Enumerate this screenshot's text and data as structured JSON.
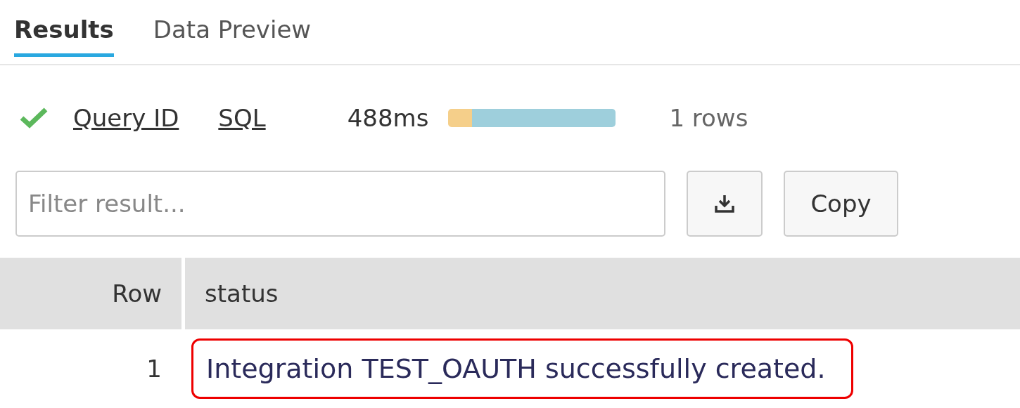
{
  "tabs": [
    {
      "label": "Results",
      "selected": true
    },
    {
      "label": "Data Preview",
      "selected": false
    }
  ],
  "query": {
    "succeeded": true,
    "links": [
      "Query ID",
      "SQL"
    ],
    "duration": "488ms",
    "timing": [
      {
        "color": "#f5cf8a",
        "level": 0.14
      },
      {
        "color": "#9ecfdc",
        "level": 0.86
      }
    ],
    "row_count": "1 rows"
  },
  "filter": {
    "placeholder": "Filter result..."
  },
  "copy_button": "Copy",
  "table": {
    "columns": [
      "Row",
      "status"
    ],
    "rows": [
      {
        "cells": [
          "1",
          "Integration TEST_OAUTH successfully created."
        ],
        "highlighted": true
      }
    ]
  }
}
